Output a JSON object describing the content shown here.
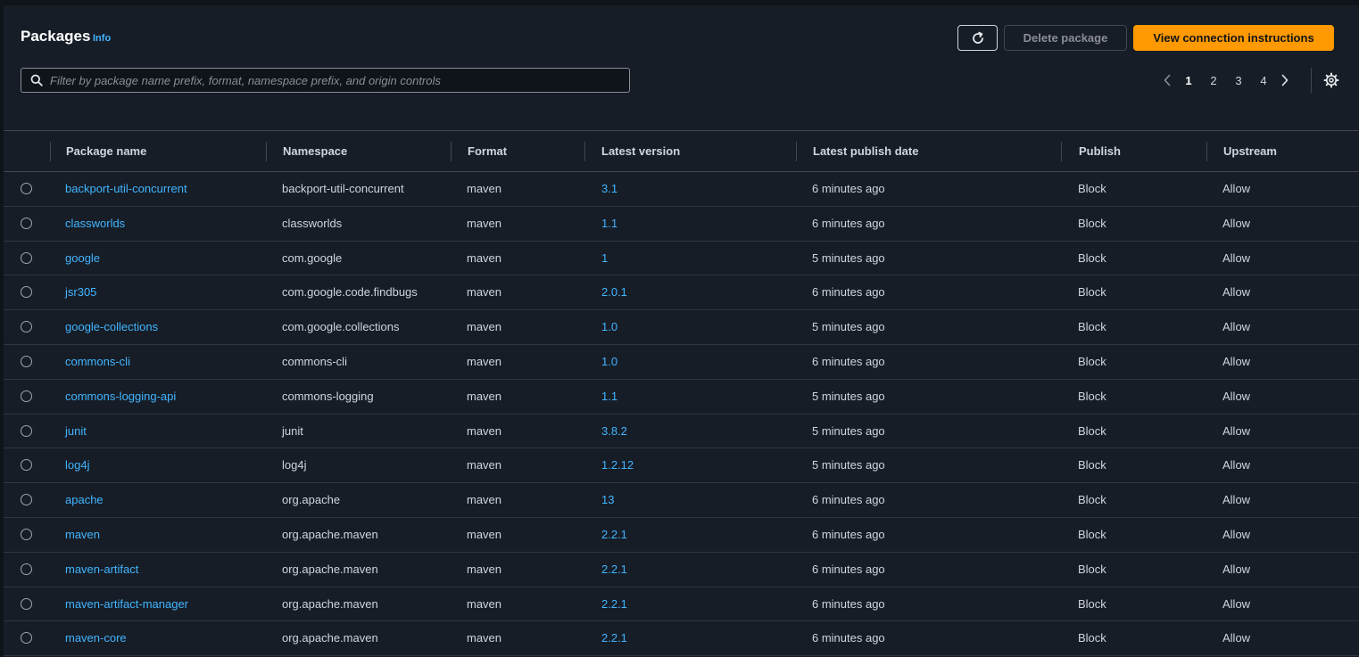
{
  "header": {
    "title": "Packages",
    "info_label": "Info",
    "delete_label": "Delete package",
    "view_label": "View connection instructions",
    "search_placeholder": "Filter by package name prefix, format, namespace prefix, and origin controls"
  },
  "pagination": {
    "pages": [
      "1",
      "2",
      "3",
      "4"
    ],
    "current": "1"
  },
  "columns": {
    "name": "Package name",
    "namespace": "Namespace",
    "format": "Format",
    "version": "Latest version",
    "date": "Latest publish date",
    "publish": "Publish",
    "upstream": "Upstream"
  },
  "rows": [
    {
      "name": "backport-util-concurrent",
      "namespace": "backport-util-concurrent",
      "format": "maven",
      "version": "3.1",
      "date": "6 minutes ago",
      "publish": "Block",
      "upstream": "Allow"
    },
    {
      "name": "classworlds",
      "namespace": "classworlds",
      "format": "maven",
      "version": "1.1",
      "date": "6 minutes ago",
      "publish": "Block",
      "upstream": "Allow"
    },
    {
      "name": "google",
      "namespace": "com.google",
      "format": "maven",
      "version": "1",
      "date": "5 minutes ago",
      "publish": "Block",
      "upstream": "Allow"
    },
    {
      "name": "jsr305",
      "namespace": "com.google.code.findbugs",
      "format": "maven",
      "version": "2.0.1",
      "date": "6 minutes ago",
      "publish": "Block",
      "upstream": "Allow"
    },
    {
      "name": "google-collections",
      "namespace": "com.google.collections",
      "format": "maven",
      "version": "1.0",
      "date": "5 minutes ago",
      "publish": "Block",
      "upstream": "Allow"
    },
    {
      "name": "commons-cli",
      "namespace": "commons-cli",
      "format": "maven",
      "version": "1.0",
      "date": "6 minutes ago",
      "publish": "Block",
      "upstream": "Allow"
    },
    {
      "name": "commons-logging-api",
      "namespace": "commons-logging",
      "format": "maven",
      "version": "1.1",
      "date": "5 minutes ago",
      "publish": "Block",
      "upstream": "Allow"
    },
    {
      "name": "junit",
      "namespace": "junit",
      "format": "maven",
      "version": "3.8.2",
      "date": "5 minutes ago",
      "publish": "Block",
      "upstream": "Allow"
    },
    {
      "name": "log4j",
      "namespace": "log4j",
      "format": "maven",
      "version": "1.2.12",
      "date": "5 minutes ago",
      "publish": "Block",
      "upstream": "Allow"
    },
    {
      "name": "apache",
      "namespace": "org.apache",
      "format": "maven",
      "version": "13",
      "date": "6 minutes ago",
      "publish": "Block",
      "upstream": "Allow"
    },
    {
      "name": "maven",
      "namespace": "org.apache.maven",
      "format": "maven",
      "version": "2.2.1",
      "date": "6 minutes ago",
      "publish": "Block",
      "upstream": "Allow"
    },
    {
      "name": "maven-artifact",
      "namespace": "org.apache.maven",
      "format": "maven",
      "version": "2.2.1",
      "date": "6 minutes ago",
      "publish": "Block",
      "upstream": "Allow"
    },
    {
      "name": "maven-artifact-manager",
      "namespace": "org.apache.maven",
      "format": "maven",
      "version": "2.2.1",
      "date": "6 minutes ago",
      "publish": "Block",
      "upstream": "Allow"
    },
    {
      "name": "maven-core",
      "namespace": "org.apache.maven",
      "format": "maven",
      "version": "2.2.1",
      "date": "6 minutes ago",
      "publish": "Block",
      "upstream": "Allow"
    }
  ],
  "icons": {
    "refresh": "refresh-icon",
    "search": "search-icon",
    "prev": "chevron-left-icon",
    "next": "chevron-right-icon",
    "settings": "gear-icon"
  },
  "colors": {
    "accent": "#ff9900",
    "link": "#42b4ff",
    "background": "#161d26"
  }
}
